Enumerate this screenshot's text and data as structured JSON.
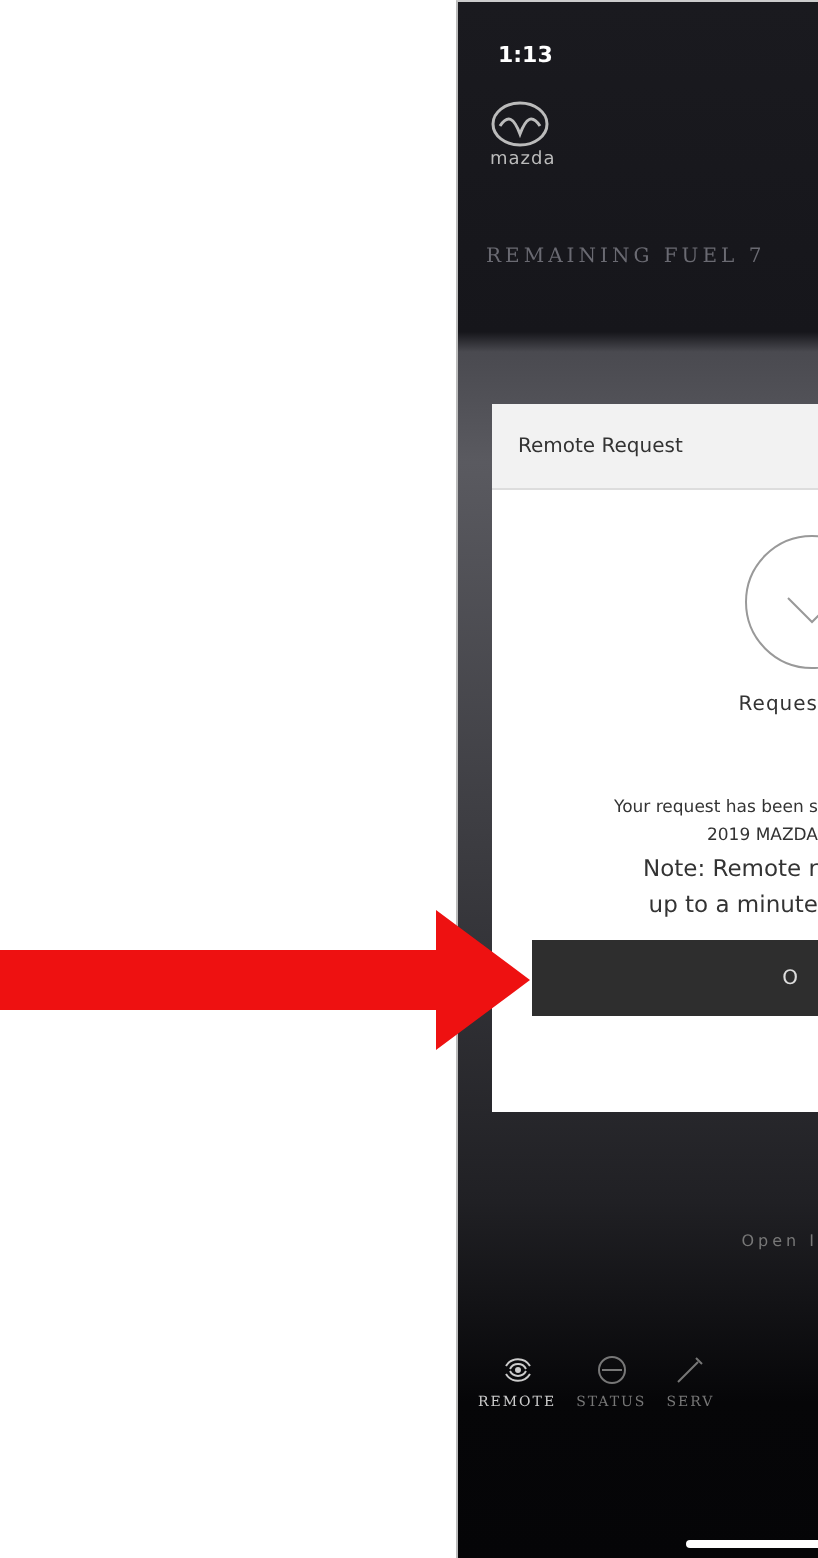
{
  "status_bar": {
    "time": "1:13"
  },
  "logo": {
    "wordmark": "mazda"
  },
  "fuel_banner": "REMAINING FUEL 7",
  "dialog": {
    "title": "Remote Request",
    "heading": "Reques",
    "message_lines": [
      "Your request has been s",
      "2019 MAZDA"
    ],
    "note_lines": [
      "Note: Remote r",
      "up to a minute"
    ],
    "button": "O"
  },
  "background_action": "Open I",
  "tabs": [
    {
      "label": "REMOTE",
      "selected": true
    },
    {
      "label": "STATUS",
      "selected": false
    },
    {
      "label": "SERV",
      "selected": false
    }
  ]
}
